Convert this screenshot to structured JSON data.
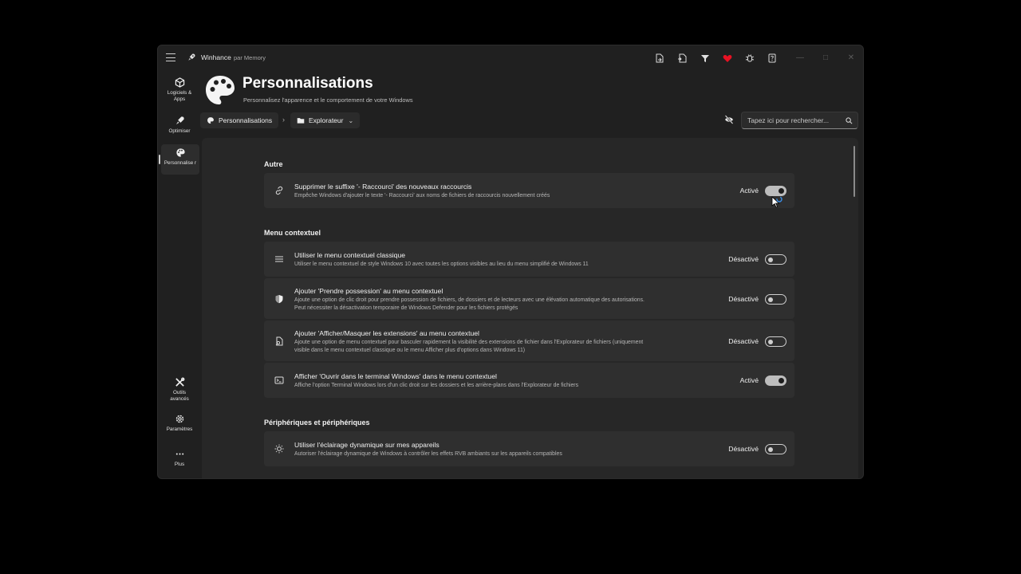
{
  "app": {
    "name": "Winhance",
    "by": "par Memory"
  },
  "colors": {
    "heart": "#e81123",
    "window_bg": "#202020",
    "content_bg": "#272727",
    "card_bg": "#2f2f2f"
  },
  "title_icons": [
    "export-icon",
    "import-icon",
    "filter-icon",
    "heart-icon",
    "bug-icon",
    "help-icon"
  ],
  "nav": {
    "software": "Logiciels & Apps",
    "optimize": "Optimiser",
    "customize": "Personnalise r",
    "advanced": "Outils avancés",
    "settings": "Paramètres",
    "more": "Plus"
  },
  "header": {
    "title": "Personnalisations",
    "subtitle": "Personnalisez l'apparence et le comportement de votre Windows"
  },
  "breadcrumb": {
    "root": "Personnalisations",
    "current": "Explorateur"
  },
  "search": {
    "placeholder": "Tapez ici pour rechercher..."
  },
  "sections": {
    "autre": "Autre",
    "menu": "Menu contextuel",
    "peripheriques": "Périphériques et périphériques"
  },
  "settings": [
    {
      "title": "Supprimer le suffixe '- Raccourci' des nouveaux raccourcis",
      "desc": "Empêche Windows d'ajouter le texte '- Raccourci' aux noms de fichiers de raccourcis nouvellement créés",
      "state": "Activé",
      "on": true
    },
    {
      "title": "Utiliser le menu contextuel classique",
      "desc": "Utiliser le menu contextuel de style Windows 10 avec toutes les options visibles au lieu du menu simplifié de Windows 11",
      "state": "Désactivé",
      "on": false
    },
    {
      "title": "Ajouter 'Prendre possession' au menu contextuel",
      "desc": "Ajoute une option de clic droit pour prendre possession de fichiers, de dossiers et de lecteurs avec une élévation automatique des autorisations.",
      "desc2": "Peut nécessiter la désactivation temporaire de Windows Defender pour les fichiers protégés",
      "state": "Désactivé",
      "on": false
    },
    {
      "title": "Ajouter 'Afficher/Masquer les extensions' au menu contextuel",
      "desc": "Ajoute une option de menu contextuel pour basculer rapidement la visibilité des extensions de fichier dans l'Explorateur de fichiers (uniquement",
      "desc2": "visible dans le menu contextuel classique ou le menu Afficher plus d'options dans Windows 11)",
      "state": "Désactivé",
      "on": false
    },
    {
      "title": "Afficher 'Ouvrir dans le terminal Windows' dans le menu contextuel",
      "desc": "Affiche l'option Terminal Windows lors d'un clic droit sur les dossiers et les arrière-plans dans l'Explorateur de fichiers",
      "state": "Activé",
      "on": true
    },
    {
      "title": "Utiliser l'éclairage dynamique sur mes appareils",
      "desc": "Autoriser l'éclairage dynamique de Windows à contrôler les effets RVB ambiants sur les appareils compatibles",
      "state": "Désactivé",
      "on": false
    }
  ]
}
